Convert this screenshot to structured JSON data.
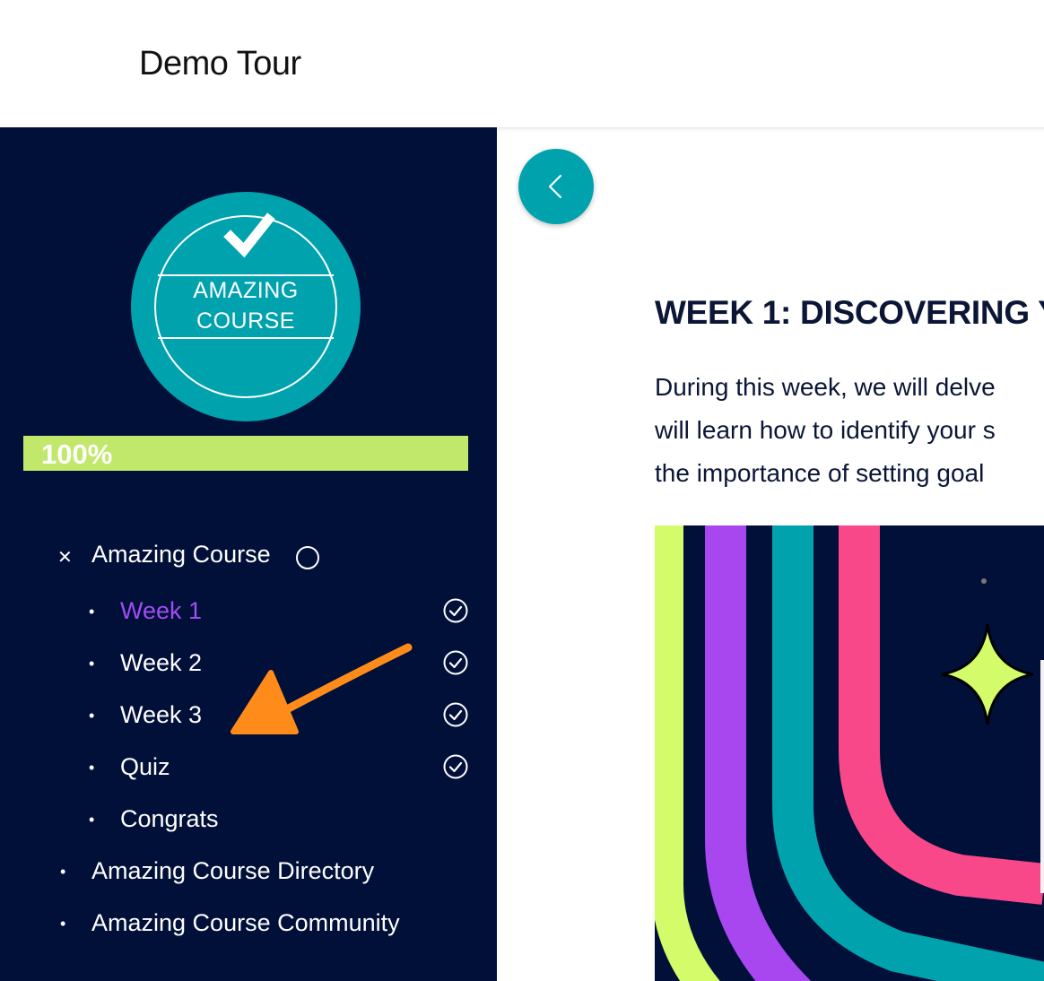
{
  "header": {
    "title": "Demo Tour"
  },
  "sidebar": {
    "badge": {
      "line1": "AMAZING",
      "line2": "COURSE"
    },
    "progress": {
      "label": "100%",
      "value": 1.0
    },
    "course": {
      "label": "Amazing Course",
      "collapse_icon": "close-icon",
      "items": [
        {
          "label": "Week 1",
          "active": true,
          "completed": true
        },
        {
          "label": "Week 2",
          "active": false,
          "completed": true
        },
        {
          "label": "Week 3",
          "active": false,
          "completed": true
        },
        {
          "label": "Quiz",
          "active": false,
          "completed": true
        },
        {
          "label": "Congrats",
          "active": false,
          "completed": false
        }
      ]
    },
    "links": [
      {
        "label": "Amazing Course Directory"
      },
      {
        "label": "Amazing Course Community"
      }
    ]
  },
  "main": {
    "back_icon": "chevron-left-icon",
    "heading": "WEEK 1: DISCOVERING Y",
    "paragraph_lines": [
      "During this week, we will delve",
      "will learn how to identify your s",
      "the importance of setting goal"
    ]
  },
  "colors": {
    "sidebar_bg": "#011039",
    "accent_teal": "#00a2ae",
    "progress_green": "#c2e86b",
    "active_item": "#a24cf5",
    "arrow_orange": "#ff8c1a",
    "stripe_lime": "#d4fb6a",
    "stripe_purple": "#a846f0",
    "stripe_pink": "#f8488a"
  }
}
